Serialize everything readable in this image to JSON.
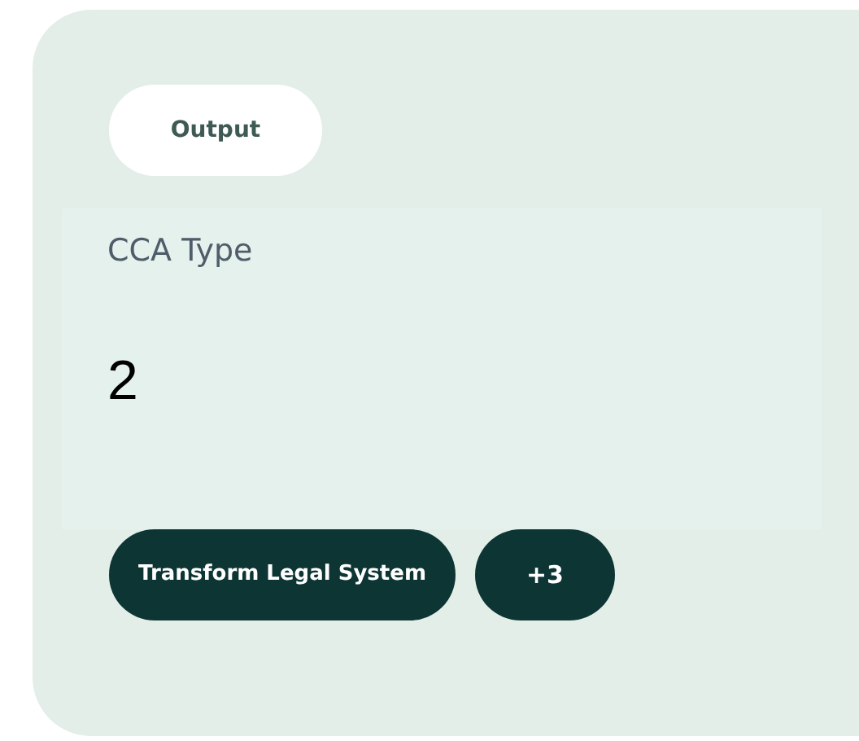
{
  "badge": {
    "label": "Output"
  },
  "field": {
    "label": "CCA Type",
    "value": "2"
  },
  "tags": [
    {
      "label": "Transform Legal System",
      "kind": "tag"
    },
    {
      "label": "+3",
      "kind": "more"
    }
  ]
}
